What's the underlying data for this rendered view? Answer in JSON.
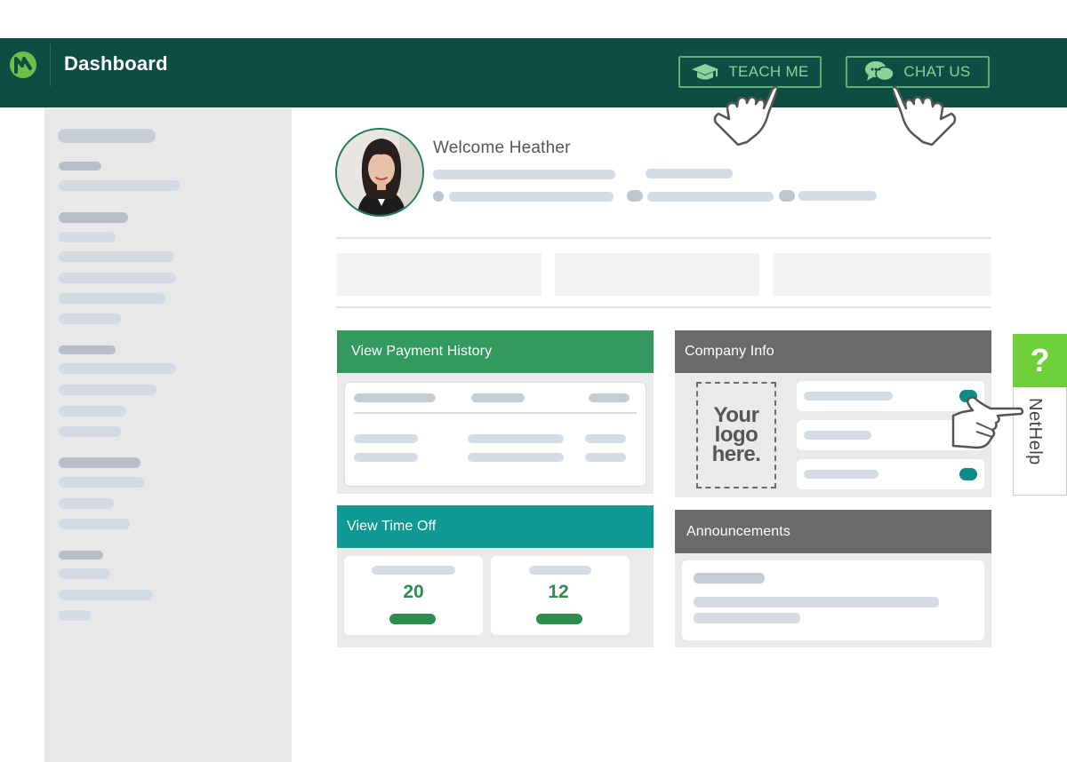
{
  "header": {
    "title": "Dashboard",
    "teach_label": "TEACH ME",
    "chat_label": "CHAT US",
    "bg_color": "#0e4d43",
    "accent_color": "#8fd19a",
    "icons": {
      "logo": "brand-n-logo-icon",
      "teach": "graduation-cap-icon",
      "chat": "chat-bubbles-icon"
    }
  },
  "welcome": {
    "greeting": "Welcome Heather"
  },
  "cards": {
    "payment": {
      "title": "View Payment History",
      "color": "#33995f"
    },
    "company": {
      "title": "Company Info",
      "color": "#6a6a6a",
      "logo_placeholder": [
        "Your",
        "logo",
        "here."
      ]
    },
    "timeoff": {
      "title": "View Time Off",
      "color": "#0f9994",
      "stats": [
        "20",
        "12"
      ]
    },
    "announcements": {
      "title": "Announcements",
      "color": "#6a6a6a"
    }
  },
  "nethelp": {
    "question_mark": "?",
    "label": "NetHelp",
    "color": "#6fcf3a"
  },
  "icons": [
    "pointing-hand-icon"
  ]
}
